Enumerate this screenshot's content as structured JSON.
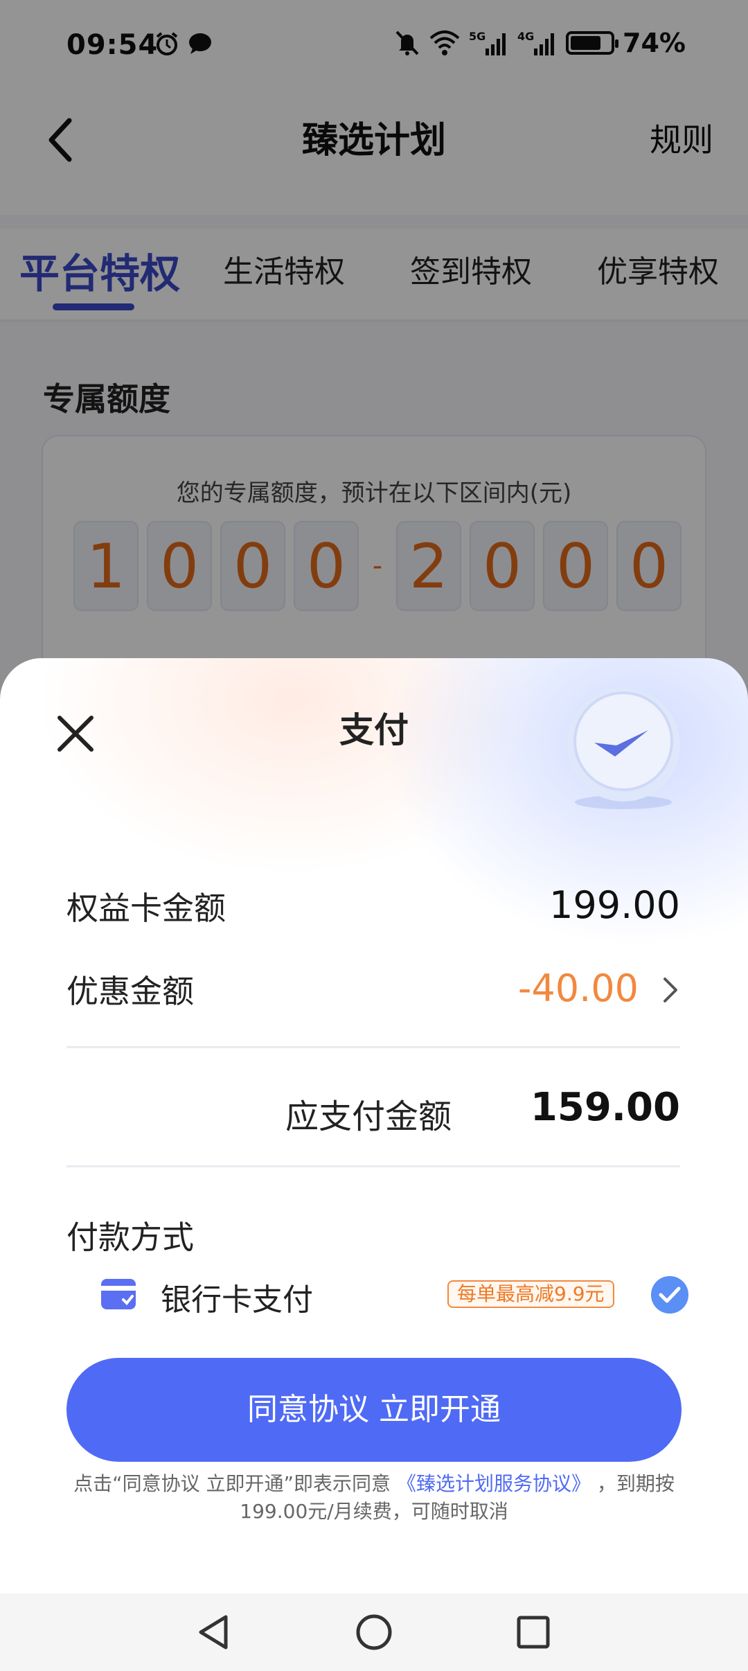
{
  "status_bar": {
    "time": "09:54",
    "battery": "74%",
    "icons": [
      "alarm-icon",
      "message-icon",
      "mute-icon",
      "wifi-icon",
      "5g-signal-icon",
      "4g-signal-icon",
      "battery-icon"
    ]
  },
  "nav": {
    "title": "臻选计划",
    "right_action": "规则"
  },
  "tabs": [
    {
      "label": "平台特权",
      "active": true
    },
    {
      "label": "生活特权",
      "active": false
    },
    {
      "label": "签到特权",
      "active": false
    },
    {
      "label": "优享特权",
      "active": false
    }
  ],
  "quota": {
    "section_title": "专属额度",
    "subtitle": "您的专属额度，预计在以下区间内(元)",
    "digits_left": [
      "1",
      "0",
      "0",
      "0"
    ],
    "separator": "-",
    "digits_right": [
      "2",
      "0",
      "0",
      "0"
    ]
  },
  "payment_sheet": {
    "title": "支付",
    "card_amount_label": "权益卡金额",
    "card_amount_value": "199.00",
    "discount_label": "优惠金额",
    "discount_value": "-40.00",
    "total_label": "应支付金额",
    "total_value": "159.00",
    "method_title": "付款方式",
    "method_label": "银行卡支付",
    "promo_tag": "每单最高减9.9元",
    "cta_label": "同意协议 立即开通",
    "agreement_prefix": "点击“同意协议 立即开通”即表示同意",
    "agreement_link": "《臻选计划服务协议》",
    "agreement_suffix": "，到期按199.00元/月续费，可随时取消"
  },
  "colors": {
    "accent": "#4f6af5",
    "tab_active": "#3b49c9",
    "discount": "#f2883f",
    "digit": "#e06a1a"
  }
}
